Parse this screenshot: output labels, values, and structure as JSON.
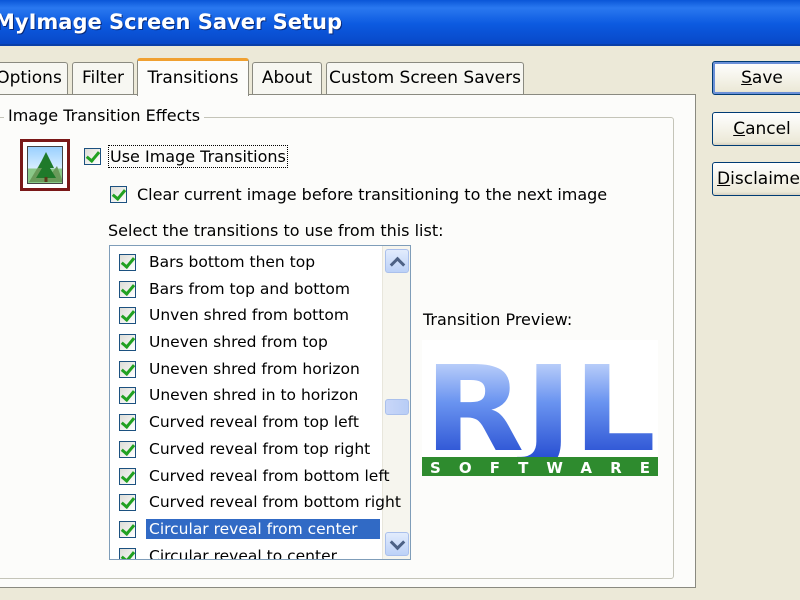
{
  "window": {
    "title": "MyImage Screen Saver Setup"
  },
  "tabs": [
    {
      "label": "Options"
    },
    {
      "label": "Filter"
    },
    {
      "label": "Transitions"
    },
    {
      "label": "About"
    },
    {
      "label": "Custom Screen Savers"
    }
  ],
  "transitions": {
    "group_label": "Image Transition Effects",
    "use_transitions": {
      "label": "Use Image Transitions",
      "checked": true
    },
    "clear_image": {
      "label": "Clear current image before transitioning to the next image",
      "checked": true
    },
    "list_label": "Select the transitions to use from this list:",
    "items": [
      {
        "label": "Bars bottom then top",
        "checked": true
      },
      {
        "label": "Bars from top and bottom",
        "checked": true
      },
      {
        "label": "Unven shred from bottom",
        "checked": true
      },
      {
        "label": "Uneven shred from top",
        "checked": true
      },
      {
        "label": "Uneven shred from horizon",
        "checked": true
      },
      {
        "label": "Uneven shred in to horizon",
        "checked": true
      },
      {
        "label": "Curved reveal from top left",
        "checked": true
      },
      {
        "label": "Curved reveal from top right",
        "checked": true
      },
      {
        "label": "Curved reveal from bottom left",
        "checked": true
      },
      {
        "label": "Curved reveal from bottom right",
        "checked": true
      },
      {
        "label": "Circular reveal from center",
        "checked": true,
        "selected": true
      },
      {
        "label": "Circular reveal to center",
        "checked": true
      }
    ],
    "preview_label": "Transition Preview:",
    "logo": {
      "main": "RJL",
      "sub": "SOFTWARE",
      "colors": {
        "blue": "#1a4fd8",
        "green": "#2e8b2e"
      }
    }
  },
  "buttons": {
    "save": {
      "label": "Save",
      "hotkey": "S",
      "rest": "ave"
    },
    "cancel": {
      "label": "Cancel",
      "hotkey": "C",
      "rest": "ancel"
    },
    "disclaimer": {
      "label": "Disclaimer",
      "hotkey": "D",
      "rest": "isclaimer"
    }
  }
}
